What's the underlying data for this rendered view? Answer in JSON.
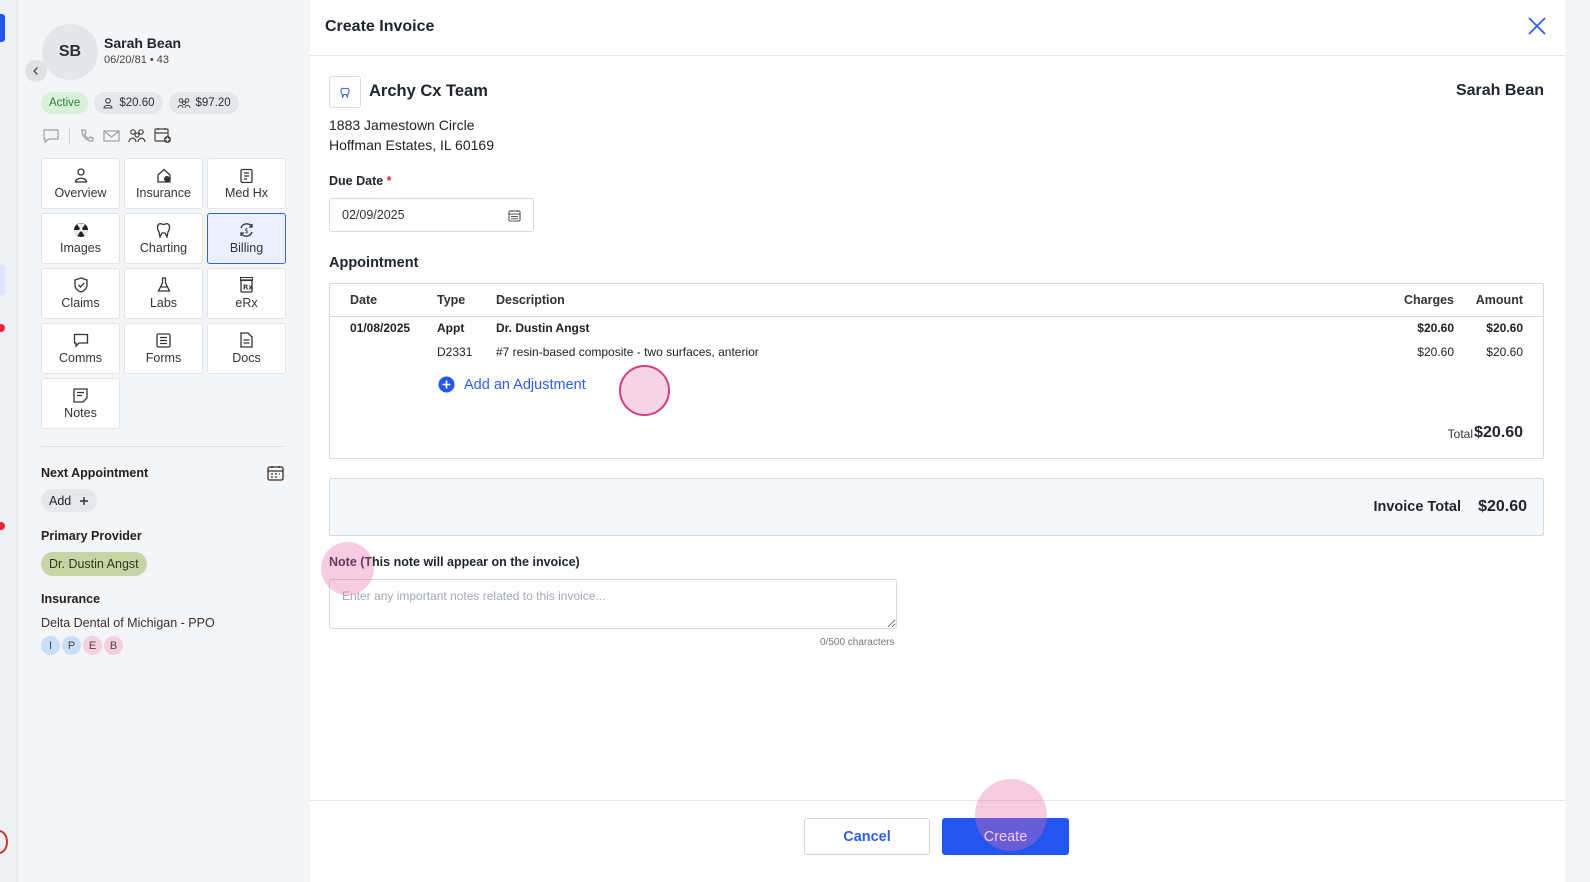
{
  "patient": {
    "initials": "SB",
    "name": "Sarah Bean",
    "dob_age": "06/20/81 • 43",
    "status": "Active",
    "balance_patient": "$20.60",
    "balance_family": "$97.20",
    "tiles": [
      {
        "label": "Overview",
        "icon": "person-icon"
      },
      {
        "label": "Insurance",
        "icon": "house-dollar-icon"
      },
      {
        "label": "Med Hx",
        "icon": "clipboard-icon"
      },
      {
        "label": "Images",
        "icon": "radiation-icon"
      },
      {
        "label": "Charting",
        "icon": "tooth-icon"
      },
      {
        "label": "Billing",
        "icon": "billing-refresh-icon"
      },
      {
        "label": "Claims",
        "icon": "shield-check-icon"
      },
      {
        "label": "Labs",
        "icon": "flask-icon"
      },
      {
        "label": "eRx",
        "icon": "rx-icon"
      },
      {
        "label": "Comms",
        "icon": "chat-icon"
      },
      {
        "label": "Forms",
        "icon": "form-icon"
      },
      {
        "label": "Docs",
        "icon": "document-icon"
      },
      {
        "label": "Notes",
        "icon": "note-icon"
      }
    ],
    "next_appointment_label": "Next Appointment",
    "add_label": "Add",
    "primary_provider_label": "Primary Provider",
    "primary_provider": "Dr. Dustin Angst",
    "insurance_label": "Insurance",
    "insurance_name": "Delta Dental of Michigan - PPO",
    "insurance_badges": [
      "I",
      "P",
      "E",
      "B"
    ]
  },
  "modal": {
    "title": "Create Invoice",
    "clinic_name": "Archy Cx Team",
    "patient_name": "Sarah Bean",
    "address_line1": "1883 Jamestown Circle",
    "address_line2": "Hoffman Estates, IL 60169",
    "due_date_label": "Due Date",
    "due_date_required": "*",
    "due_date_value": "02/09/2025",
    "appointment_heading": "Appointment",
    "table": {
      "headers": {
        "date": "Date",
        "type": "Type",
        "description": "Description",
        "charges": "Charges",
        "amount": "Amount"
      },
      "rows": [
        {
          "date": "01/08/2025",
          "type": "Appt",
          "description": "Dr. Dustin Angst",
          "charges": "$20.60",
          "amount": "$20.60"
        },
        {
          "date": "",
          "type": "D2331",
          "description": "#7 resin-based composite - two surfaces, anterior",
          "charges": "$20.60",
          "amount": "$20.60"
        }
      ],
      "add_adjustment": "Add an Adjustment",
      "total_label": "Total",
      "total_value": "$20.60"
    },
    "invoice_total_label": "Invoice Total",
    "invoice_total_value": "$20.60",
    "note_label": "Note (This note will appear on the invoice)",
    "note_placeholder": "Enter any important notes related to this invoice...",
    "char_count": "0/500 characters",
    "cancel_label": "Cancel",
    "create_label": "Create"
  },
  "colors": {
    "accent": "#2356f0",
    "active_badge": "#d7f2d9",
    "provider_pill": "#c7d4a6",
    "required": "#e5243b"
  }
}
